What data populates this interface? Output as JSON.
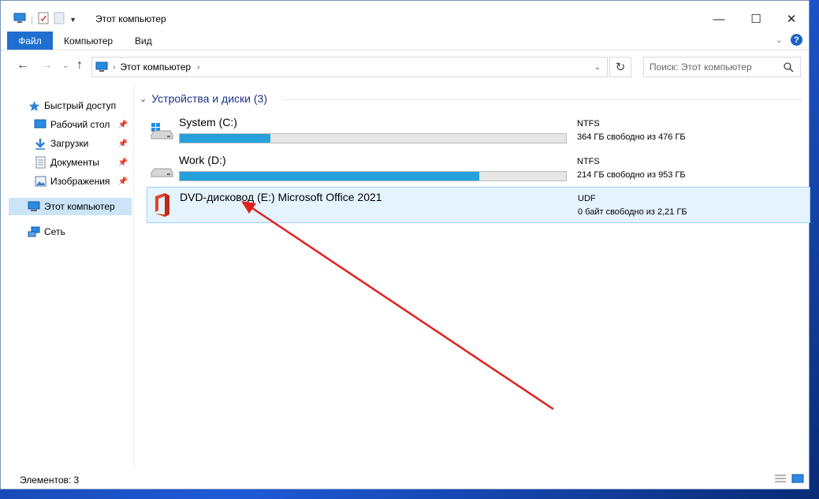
{
  "window": {
    "title": "Этот компьютер",
    "qat_icons": [
      "computer-icon",
      "properties-icon",
      "new-folder-icon",
      "qat-dropdown-icon"
    ]
  },
  "controls": {
    "minimize": "—",
    "maximize": "☐",
    "close": "✕"
  },
  "ribbon": {
    "tabs": [
      "Файл",
      "Компьютер",
      "Вид"
    ],
    "help": "?"
  },
  "address": {
    "location": "Этот компьютер",
    "search_placeholder": "Поиск: Этот компьютер"
  },
  "sidebar": {
    "items": [
      {
        "label": "Быстрый доступ",
        "icon": "star-icon"
      },
      {
        "label": "Рабочий стол",
        "icon": "desktop-icon",
        "pinned": true
      },
      {
        "label": "Загрузки",
        "icon": "download-icon",
        "pinned": true
      },
      {
        "label": "Документы",
        "icon": "document-icon",
        "pinned": true
      },
      {
        "label": "Изображения",
        "icon": "pictures-icon",
        "pinned": true
      },
      {
        "label": "Этот компьютер",
        "icon": "computer-icon",
        "selected": true
      },
      {
        "label": "Сеть",
        "icon": "network-icon"
      }
    ]
  },
  "content": {
    "group_header": "Устройства и диски (3)",
    "drives": [
      {
        "name": "System (C:)",
        "fs": "NTFS",
        "free_text": "364 ГБ свободно из 476 ГБ",
        "used_fraction": 0.235,
        "icon": "windows-drive-icon"
      },
      {
        "name": "Work (D:)",
        "fs": "NTFS",
        "free_text": "214 ГБ свободно из 953 ГБ",
        "used_fraction": 0.775,
        "icon": "drive-icon"
      },
      {
        "name": "DVD-дисковод (E:) Microsoft Office 2021",
        "fs": "UDF",
        "free_text": "0 байт свободно из 2,21 ГБ",
        "icon": "office-icon",
        "selected": true
      }
    ]
  },
  "status": {
    "text": "Элементов: 3"
  },
  "colors": {
    "accent": "#1f6fd1",
    "bar": "#26a0da",
    "selection": "#cce4f7",
    "arrow": "#e0201e"
  }
}
